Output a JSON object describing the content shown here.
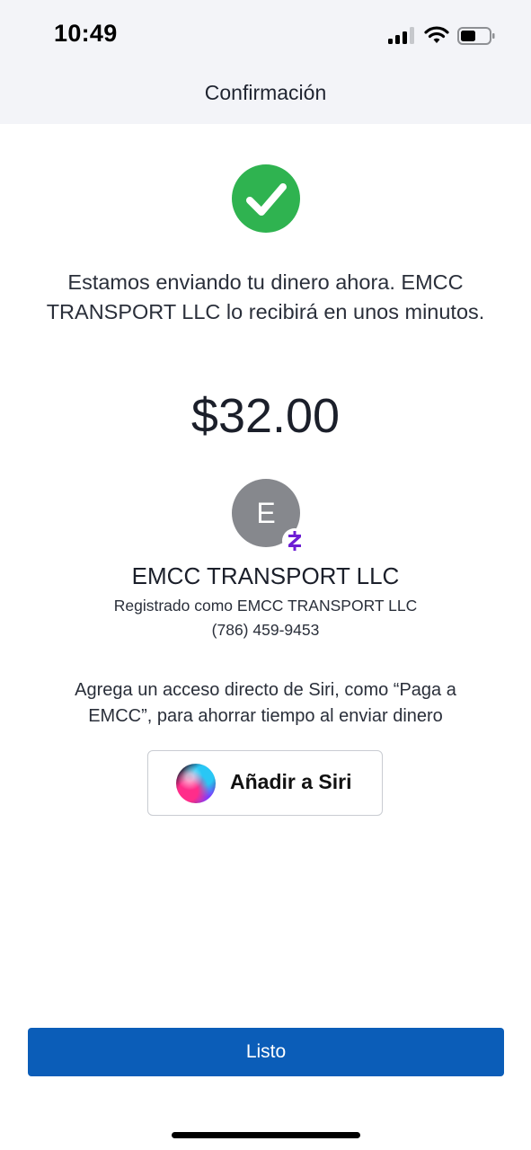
{
  "status_bar": {
    "time": "10:49",
    "icons": [
      "cellular-signal-icon",
      "wifi-icon",
      "battery-icon"
    ],
    "battery_level": 0.5
  },
  "header": {
    "title": "Confirmación"
  },
  "confirmation": {
    "icon": "check-circle-icon",
    "message": "Estamos enviando tu dinero ahora. EMCC TRANSPORT LLC lo recibirá en unos minutos.",
    "amount": "$32.00"
  },
  "recipient": {
    "avatar_initial": "E",
    "badge_icon": "zelle-icon",
    "name": "EMCC TRANSPORT LLC",
    "registered_as": "Registrado como EMCC TRANSPORT LLC",
    "phone": "(786) 459-9453"
  },
  "siri": {
    "prompt": "Agrega un acceso directo de Siri, como “Paga a EMCC”, para ahorrar tiempo al enviar dinero",
    "button_label": "Añadir a Siri",
    "icon": "siri-icon"
  },
  "footer": {
    "done_label": "Listo"
  },
  "colors": {
    "success": "#2fb350",
    "primary": "#0b5db8",
    "zelle": "#6d1ed4",
    "avatar": "#86888d"
  }
}
